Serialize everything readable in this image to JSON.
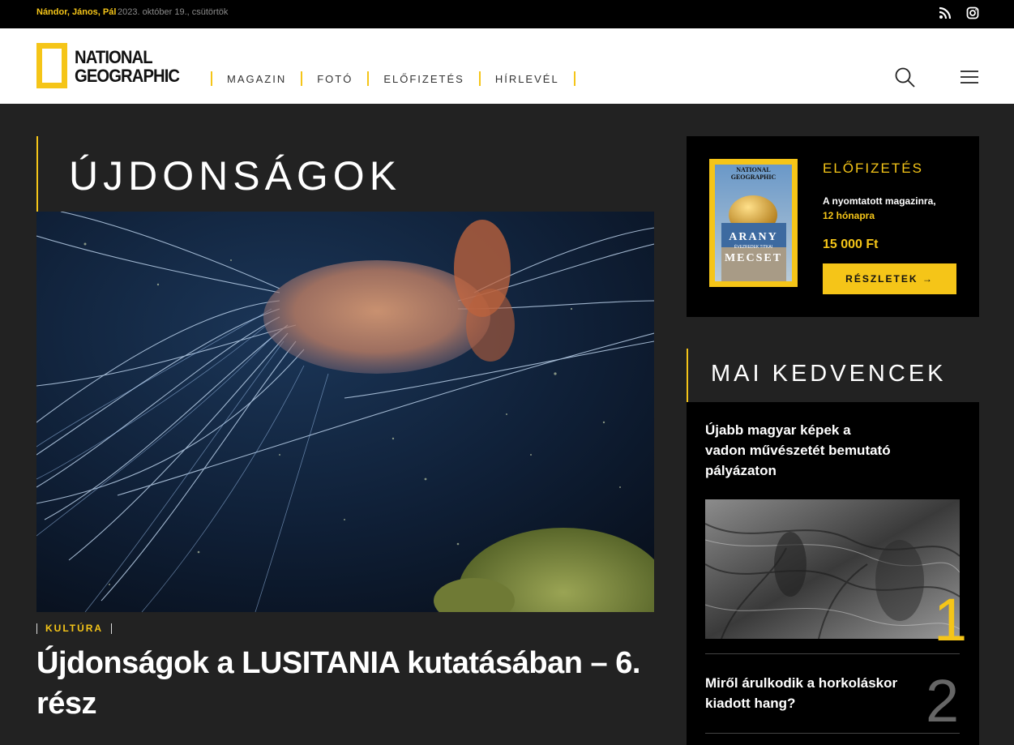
{
  "topbar": {
    "names": "Nándor, János, Pál",
    "date": "2023. október 19., csütörtök",
    "icons": [
      "rss-icon",
      "instagram-icon"
    ]
  },
  "header": {
    "logo_line1": "NATIONAL",
    "logo_line2": "GEOGRAPHIC",
    "nav": [
      "MAGAZIN",
      "FOTÓ",
      "ELŐFIZETÉS",
      "HÍRLEVÉL"
    ],
    "icons": [
      "search-icon",
      "menu-icon"
    ]
  },
  "main": {
    "section_title": "ÚJDONSÁGOK",
    "hero_image": "jellyfish-underwater-photo",
    "category": "KULTÚRA",
    "article_title": "Újdonságok a LUSITANIA kutatásában – 6. rész"
  },
  "subscription": {
    "cover_logo1": "NATIONAL",
    "cover_logo2": "GEOGRAPHIC",
    "cover_word1": "ARANY",
    "cover_sub": "ÉVEZREDEK TITKAI",
    "cover_word2": "MECSET",
    "label": "ELŐFIZETÉS",
    "line1": "A nyomtatott magazinra,",
    "line2": "12 hónapra",
    "price": "15 000 Ft",
    "button": "RÉSZLETEK →"
  },
  "favourites": {
    "title": "MAI KEDVENCEK",
    "items": [
      {
        "title": "Újabb magyar képek a vadon művészetét bemutató pályázaton",
        "rank": "1"
      },
      {
        "title": "Miről árulkodik a horkoláskor kiadott hang?",
        "rank": "2"
      }
    ]
  },
  "colors": {
    "accent": "#f5c518",
    "background": "#222222",
    "panel": "#000000"
  }
}
